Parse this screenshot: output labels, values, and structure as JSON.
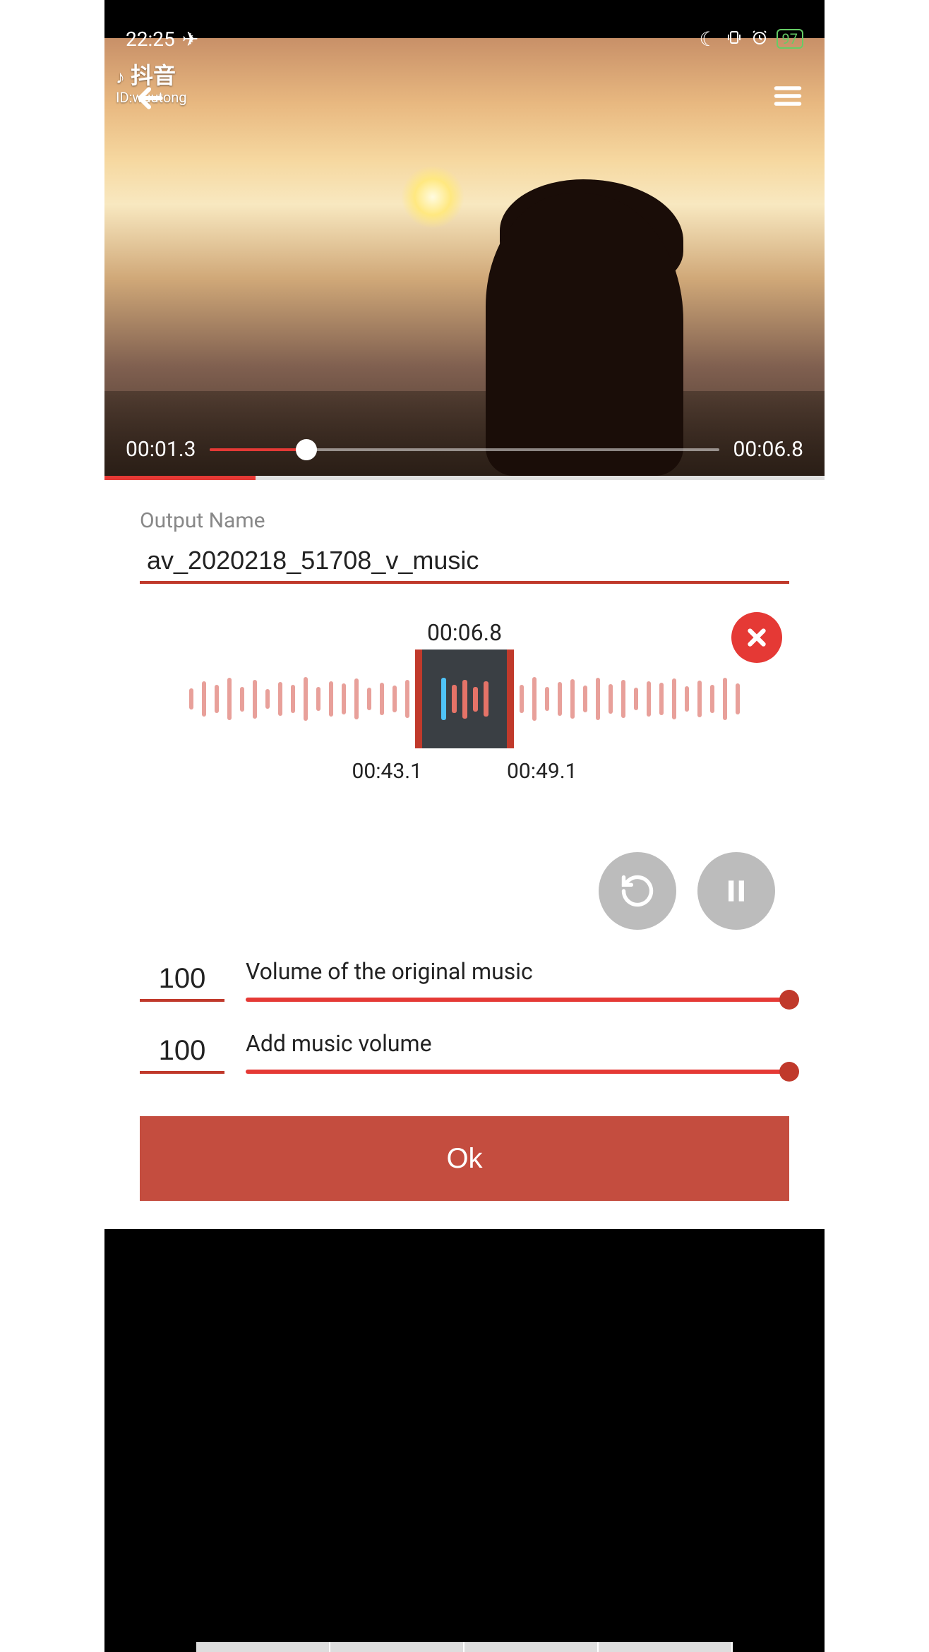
{
  "status": {
    "time": "22:25",
    "battery": "97"
  },
  "watermark": {
    "brand": "抖音",
    "id_line": "ID:wuutong"
  },
  "video": {
    "current_time": "00:01.3",
    "total_time": "00:06.8"
  },
  "output": {
    "label": "Output Name",
    "value": "av_2020218_51708_v_music"
  },
  "audio": {
    "clip_duration": "00:06.8",
    "start_time": "00:43.1",
    "end_time": "00:49.1"
  },
  "volumes": {
    "original": {
      "label": "Volume of the original music",
      "value": "100"
    },
    "added": {
      "label": "Add music volume",
      "value": "100"
    }
  },
  "ok_label": "Ok",
  "icons": {
    "airplane": "✈",
    "moon": "☾",
    "vibrate": "⦀",
    "alarm": "⏰"
  }
}
